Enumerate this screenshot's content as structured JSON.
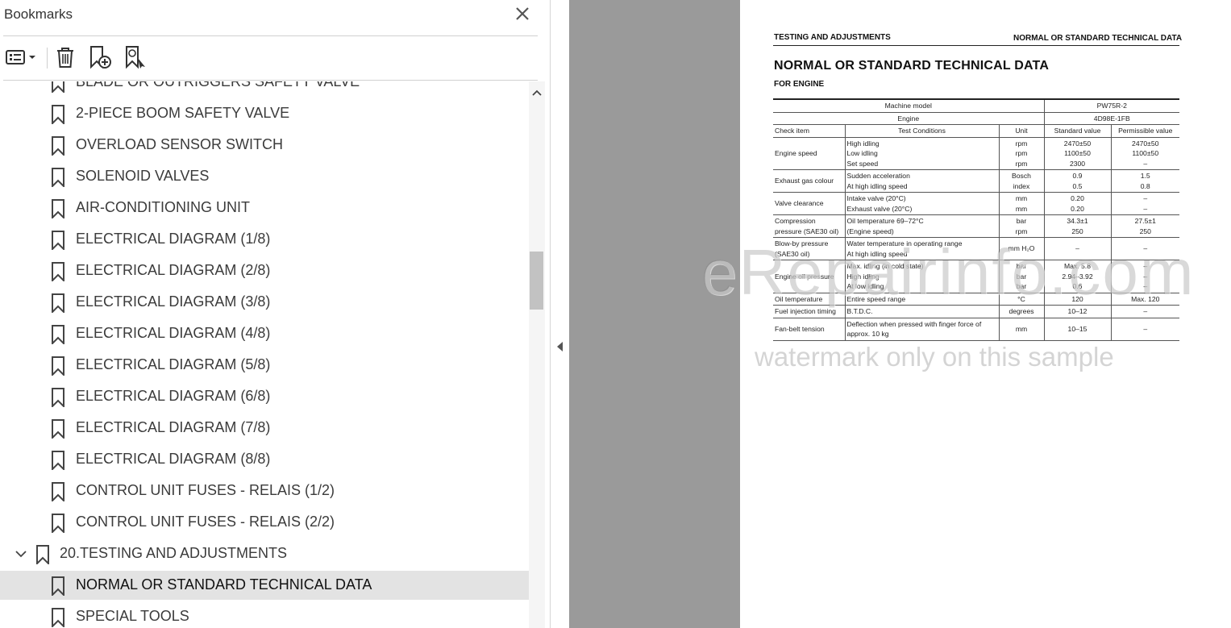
{
  "panel": {
    "title": "Bookmarks",
    "items": [
      {
        "label": "BLADE OR OUTRIGGERS SAFETY VALVE",
        "level": 2
      },
      {
        "label": "2-PIECE BOOM SAFETY VALVE",
        "level": 2
      },
      {
        "label": "OVERLOAD SENSOR SWITCH",
        "level": 2
      },
      {
        "label": "SOLENOID VALVES",
        "level": 2
      },
      {
        "label": "AIR-CONDITIONING UNIT",
        "level": 2
      },
      {
        "label": "ELECTRICAL DIAGRAM (1/8)",
        "level": 2
      },
      {
        "label": "ELECTRICAL DIAGRAM (2/8)",
        "level": 2
      },
      {
        "label": "ELECTRICAL DIAGRAM (3/8)",
        "level": 2
      },
      {
        "label": "ELECTRICAL DIAGRAM (4/8)",
        "level": 2
      },
      {
        "label": "ELECTRICAL DIAGRAM (5/8)",
        "level": 2
      },
      {
        "label": "ELECTRICAL DIAGRAM (6/8)",
        "level": 2
      },
      {
        "label": "ELECTRICAL DIAGRAM (7/8)",
        "level": 2
      },
      {
        "label": "ELECTRICAL DIAGRAM (8/8)",
        "level": 2
      },
      {
        "label": "CONTROL UNIT FUSES - RELAIS (1/2)",
        "level": 2
      },
      {
        "label": "CONTROL UNIT FUSES - RELAIS (2/2)",
        "level": 2
      },
      {
        "label": "20.TESTING AND ADJUSTMENTS",
        "level": 1,
        "expanded": true
      },
      {
        "label": "NORMAL OR STANDARD TECHNICAL DATA",
        "level": 2,
        "selected": true
      },
      {
        "label": "SPECIAL TOOLS",
        "level": 2
      }
    ]
  },
  "document": {
    "header_left": "TESTING AND ADJUSTMENTS",
    "header_right": "NORMAL OR STANDARD TECHNICAL DATA",
    "title": "NORMAL OR STANDARD TECHNICAL DATA",
    "subtitle": "FOR ENGINE",
    "table": {
      "machine_model_label": "Machine model",
      "machine_model_value": "PW75R-2",
      "engine_label": "Engine",
      "engine_value": "4D98E-1FB",
      "col_check": "Check item",
      "col_conditions": "Test Conditions",
      "col_unit": "Unit",
      "col_standard": "Standard value",
      "col_permissible": "Permissible value",
      "rows": [
        {
          "item": "Engine speed",
          "cond": [
            "High idling",
            "Low idling",
            "Set speed"
          ],
          "unit": [
            "rpm",
            "rpm",
            "rpm"
          ],
          "std": [
            "2470±50",
            "1100±50",
            "2300"
          ],
          "perm": [
            "2470±50",
            "1100±50",
            "–"
          ]
        },
        {
          "item": "Exhaust gas colour",
          "cond": [
            "Sudden acceleration",
            "At high idling speed"
          ],
          "unit": [
            "Bosch",
            "index"
          ],
          "std": [
            "0.9",
            "0.5"
          ],
          "perm": [
            "1.5",
            "0.8"
          ]
        },
        {
          "item": "Valve clearance",
          "cond": [
            "Intake valve (20°C)",
            "Exhaust valve (20°C)"
          ],
          "unit": [
            "mm",
            "mm"
          ],
          "std": [
            "0.20",
            "0.20"
          ],
          "perm": [
            "–",
            "–"
          ]
        },
        {
          "item": "Compression pressure (SAE30 oil)",
          "cond": [
            "Oil temperature 69–72°C",
            "(Engine speed)"
          ],
          "unit": [
            "bar",
            "rpm"
          ],
          "std": [
            "34.3±1",
            "250"
          ],
          "perm": [
            "27.5±1",
            "250"
          ]
        },
        {
          "item": "Blow-by pressure (SAE30 oil)",
          "cond": [
            "Water temperature in operating range",
            "At high idling speed"
          ],
          "unit": [
            "mm H₂O"
          ],
          "std": [
            "–"
          ],
          "perm": [
            "–"
          ]
        },
        {
          "item": "Engine oil  pressure",
          "cond": [
            "Max. idling (in cold state)",
            "High idling",
            "At low idling"
          ],
          "unit": [
            "bar",
            "bar",
            "bar"
          ],
          "std": [
            "Max. 5.8",
            "2.94–3.92",
            "0.6"
          ],
          "perm": [
            "–",
            "–",
            "–"
          ]
        },
        {
          "item": "Oil temperature",
          "cond": [
            "Entire speed range"
          ],
          "unit": [
            "°C"
          ],
          "std": [
            "120"
          ],
          "perm": [
            "Max. 120"
          ]
        },
        {
          "item": "Fuel injection timing",
          "cond": [
            "B.T.D.C."
          ],
          "unit": [
            "degrees"
          ],
          "std": [
            "10–12"
          ],
          "perm": [
            "–"
          ]
        },
        {
          "item": "Fan-belt tension",
          "cond": [
            "Deflection when pressed with finger force of approx. 10 kg"
          ],
          "unit": [
            "mm"
          ],
          "std": [
            "10–15"
          ],
          "perm": [
            "–"
          ]
        }
      ]
    }
  },
  "watermark": {
    "big": "eRepairinfo.com",
    "small": "watermark only on this sample"
  }
}
